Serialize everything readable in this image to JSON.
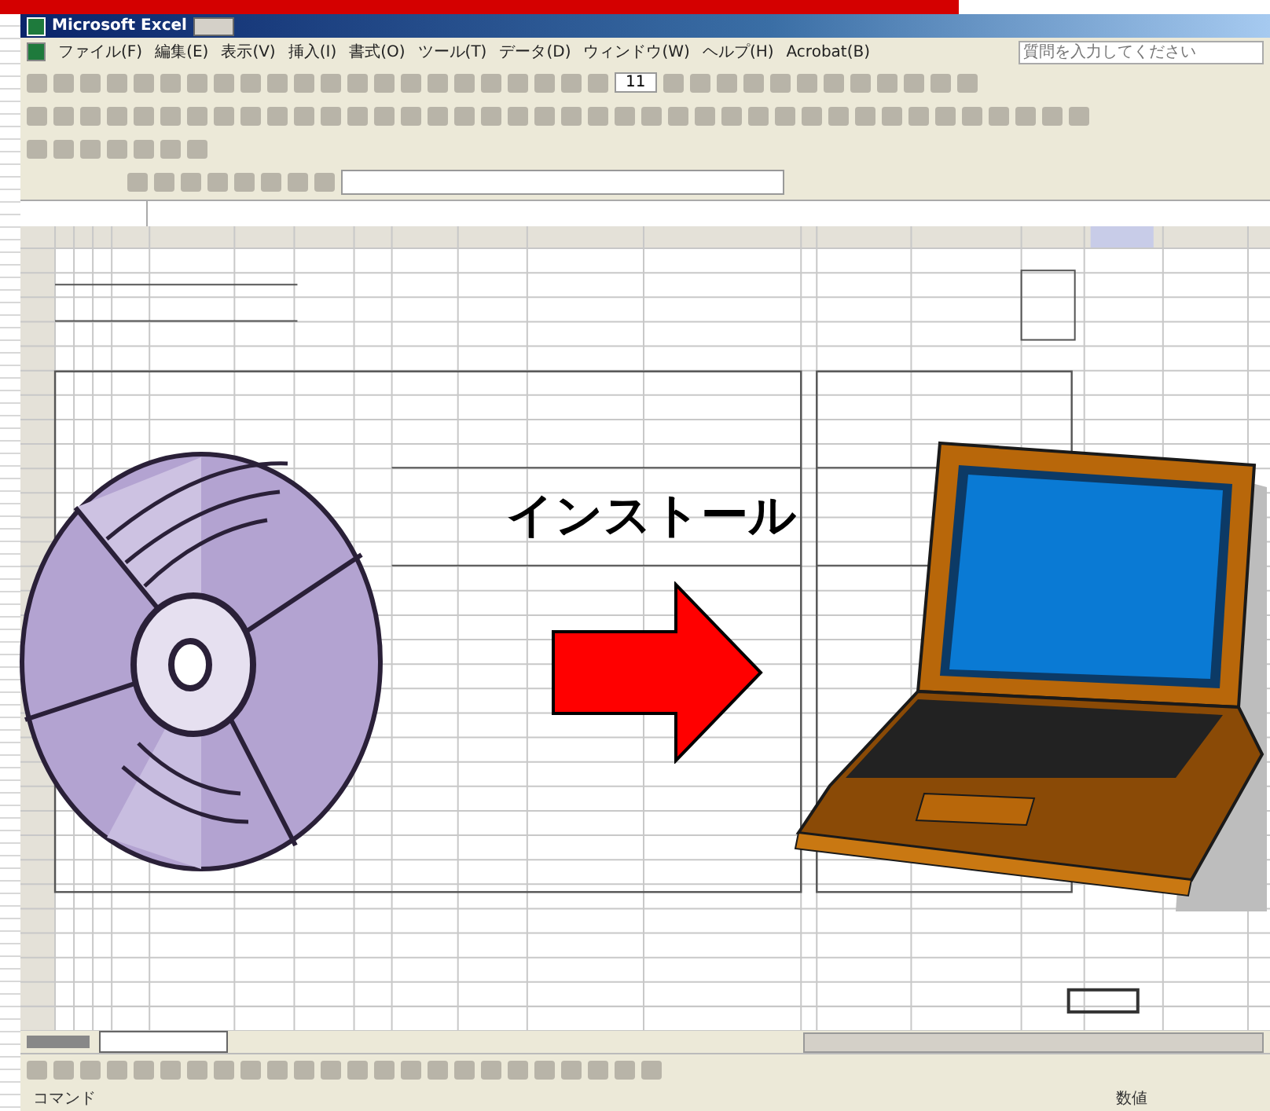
{
  "window": {
    "title": "Microsoft Excel"
  },
  "menu": [
    {
      "label": "ファイル(F)"
    },
    {
      "label": "編集(E)"
    },
    {
      "label": "表示(V)"
    },
    {
      "label": "挿入(I)"
    },
    {
      "label": "書式(O)"
    },
    {
      "label": "ツール(T)"
    },
    {
      "label": "データ(D)"
    },
    {
      "label": "ウィンドウ(W)"
    },
    {
      "label": "ヘルプ(H)"
    },
    {
      "label": "Acrobat(B)"
    }
  ],
  "help_box": {
    "placeholder": "質問を入力してください"
  },
  "font_size": "11",
  "caption": "インストール",
  "status_bar": {
    "mode": "コマンド",
    "indicator": "数値"
  }
}
